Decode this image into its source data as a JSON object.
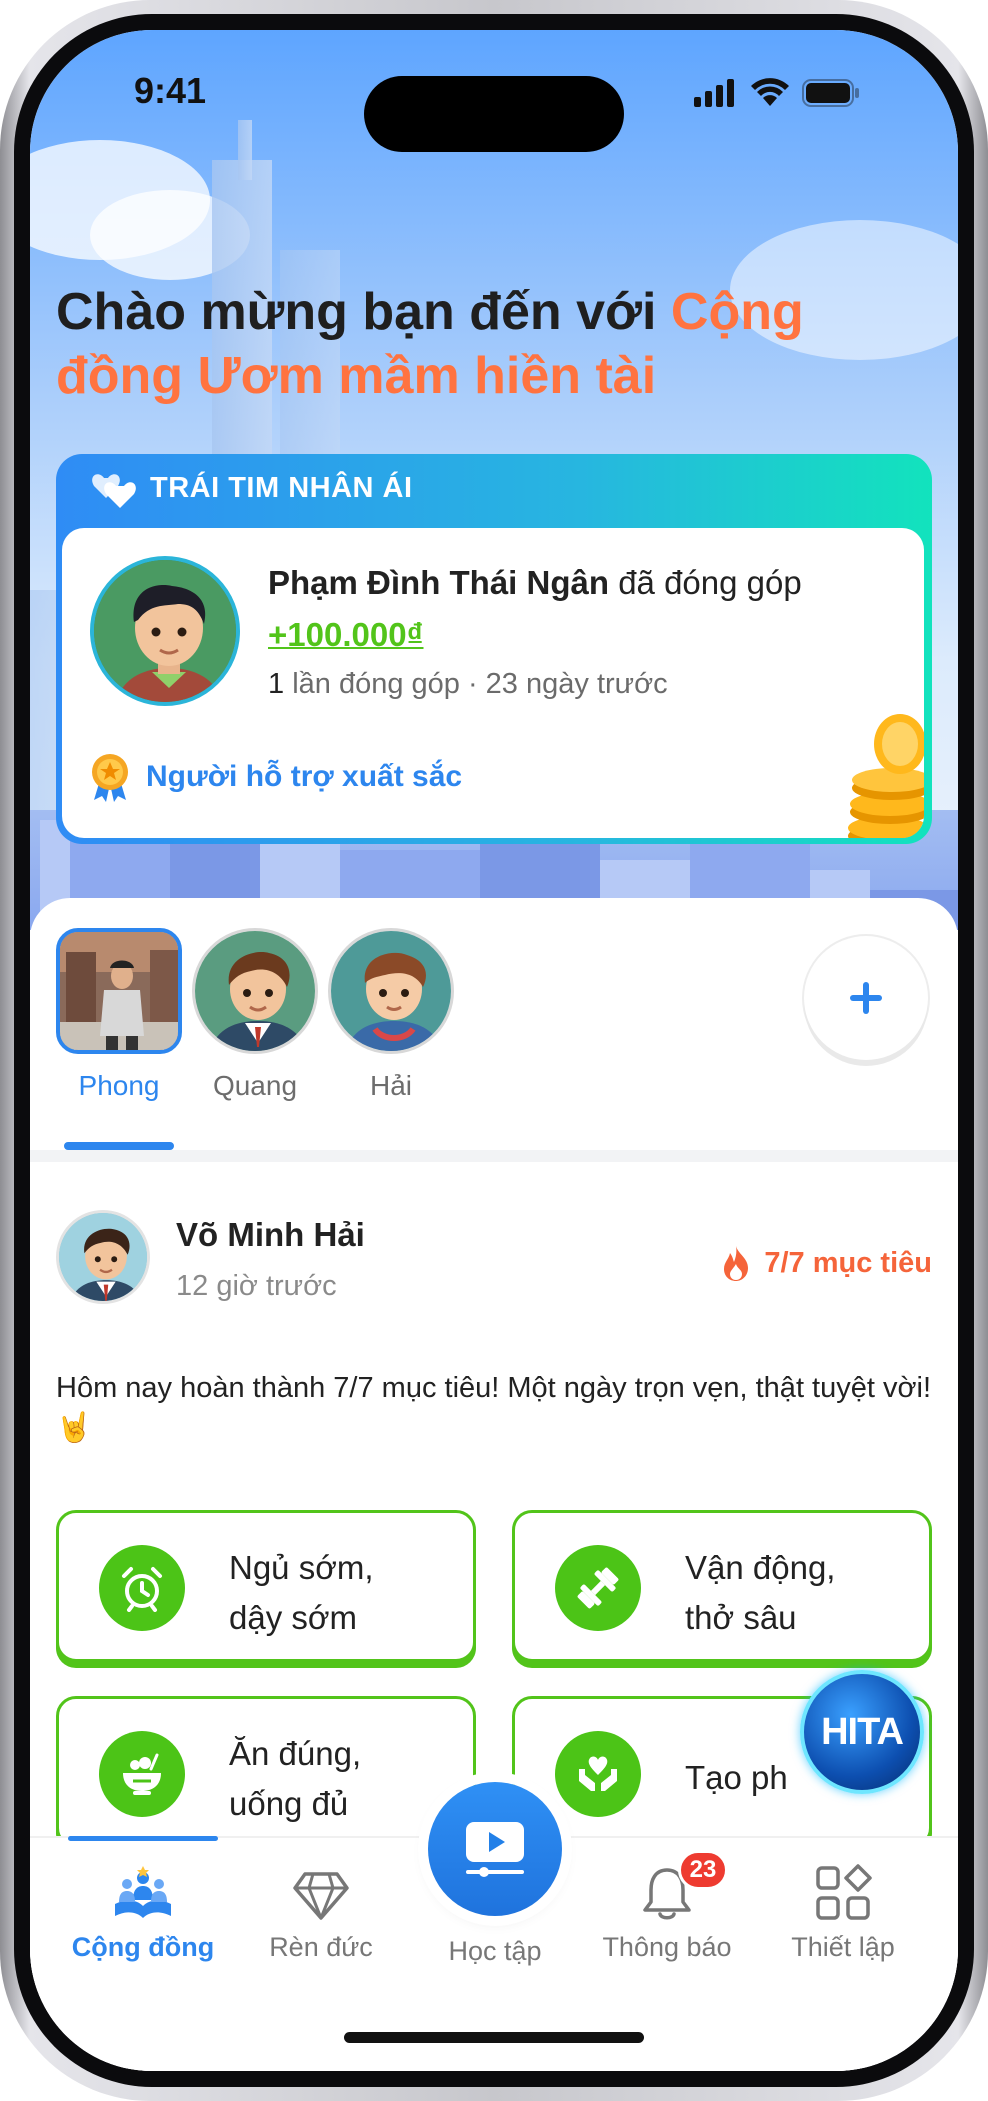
{
  "status_bar": {
    "time": "9:41"
  },
  "welcome": {
    "prefix": "Chào mừng bạn đến với ",
    "accent": "Cộng đồng Ươm mầm hiền tài"
  },
  "heart_card": {
    "title": "TRÁI TIM NHÂN ÁI",
    "donor_name": "Phạm Đình Thái Ngân",
    "donor_action": " đã đóng góp",
    "amount": "+100.000₫",
    "count": "1",
    "meta": " lần đóng góp · 23 ngày trước",
    "award": "Người hỗ trợ xuất sắc"
  },
  "stories": [
    {
      "name": "Phong",
      "active": true
    },
    {
      "name": "Quang",
      "active": false
    },
    {
      "name": "Hải",
      "active": false
    }
  ],
  "post": {
    "author": "Võ Minh Hải",
    "time": "12 giờ trước",
    "goal_badge": "7/7 mục tiêu",
    "body": "Hôm nay hoàn thành 7/7 mục tiêu! Một ngày trọn vẹn, thật tuyệt vời! 🤘",
    "goals": [
      {
        "line1": "Ngủ sớm,",
        "line2": "dậy sớm",
        "icon": "alarm-clock-icon"
      },
      {
        "line1": "Vận động,",
        "line2": "thở sâu",
        "icon": "dumbbell-icon"
      },
      {
        "line1": "Ăn đúng,",
        "line2": "uống đủ",
        "icon": "food-bowl-icon"
      },
      {
        "line1": "Tạo ph",
        "line2": "",
        "icon": "heart-hands-icon"
      }
    ]
  },
  "floating_badge": {
    "text": "HITA"
  },
  "bottom_nav": {
    "items": [
      {
        "label": "Cộng đồng",
        "icon": "community-icon",
        "active": true
      },
      {
        "label": "Rèn đức",
        "icon": "diamond-icon",
        "active": false
      },
      {
        "label": "Học tập",
        "icon": "video-play-icon",
        "active": false
      },
      {
        "label": "Thông báo",
        "icon": "bell-icon",
        "active": false
      },
      {
        "label": "Thiết lập",
        "icon": "grid-settings-icon",
        "active": false
      }
    ],
    "notification_count": "23"
  },
  "colors": {
    "accent": "#ff7340",
    "brand_blue": "#2d86ee",
    "goal_green": "#52c41a"
  }
}
